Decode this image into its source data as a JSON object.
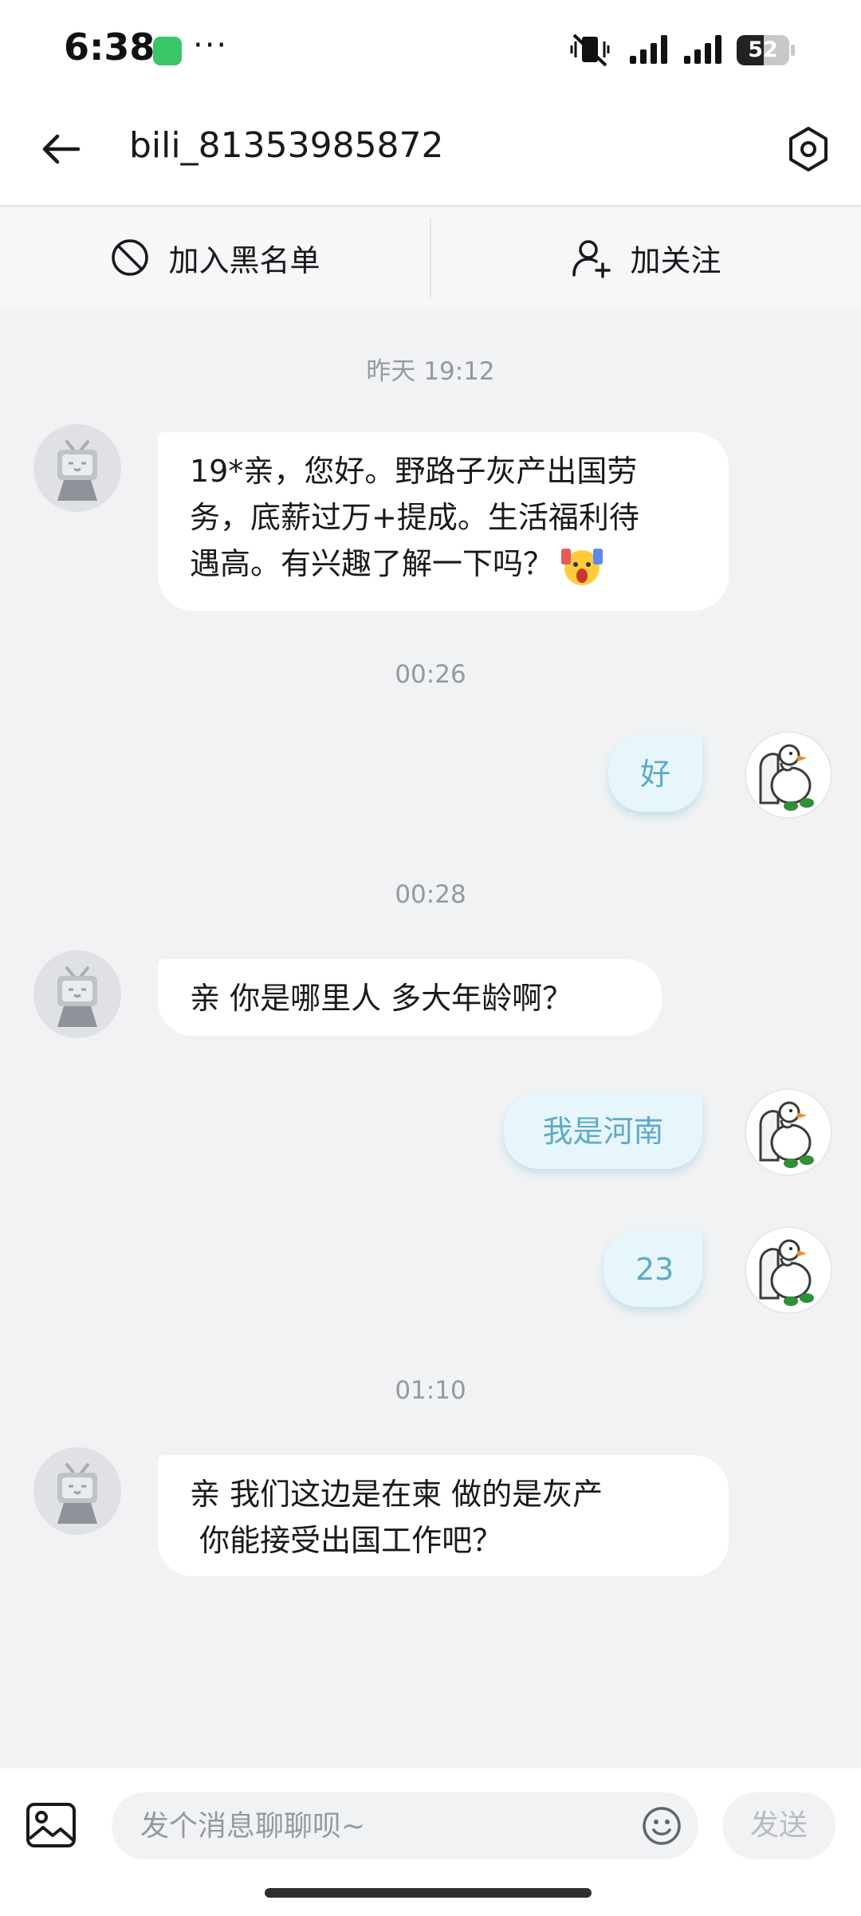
{
  "status_bar": {
    "time": "6:38",
    "more": "···",
    "battery": "52",
    "battery_level": 0.52
  },
  "header": {
    "title": "bili_81353985872"
  },
  "actions": {
    "block_label": "加入黑名单",
    "follow_label": "加关注"
  },
  "messages": [
    {
      "type": "timestamp",
      "text": "昨天 19:12"
    },
    {
      "type": "in",
      "lines": [
        "19*亲，您好。野路子灰产出国劳",
        "务，底薪过万+提成。生活福利待",
        "遇高。有兴趣了解一下吗？"
      ],
      "emoji": "scream-emoji"
    },
    {
      "type": "timestamp",
      "text": "00:26"
    },
    {
      "type": "out",
      "text": "好"
    },
    {
      "type": "timestamp",
      "text": "00:28"
    },
    {
      "type": "in",
      "lines": [
        "亲 你是哪里人  多大年龄啊？"
      ]
    },
    {
      "type": "out",
      "text": "我是河南"
    },
    {
      "type": "out",
      "text": "23"
    },
    {
      "type": "timestamp",
      "text": "01:10"
    },
    {
      "type": "in",
      "lines": [
        "亲 我们这边是在柬 做的是灰产",
        " 你能接受出国工作吧？"
      ]
    }
  ],
  "input": {
    "placeholder": "发个消息聊聊呗~",
    "value": "",
    "send_label": "发送"
  },
  "colors": {
    "bubble_out": "#e7f6fb",
    "bubble_out_text": "#5fa9c8",
    "background": "#f1f2f3"
  }
}
